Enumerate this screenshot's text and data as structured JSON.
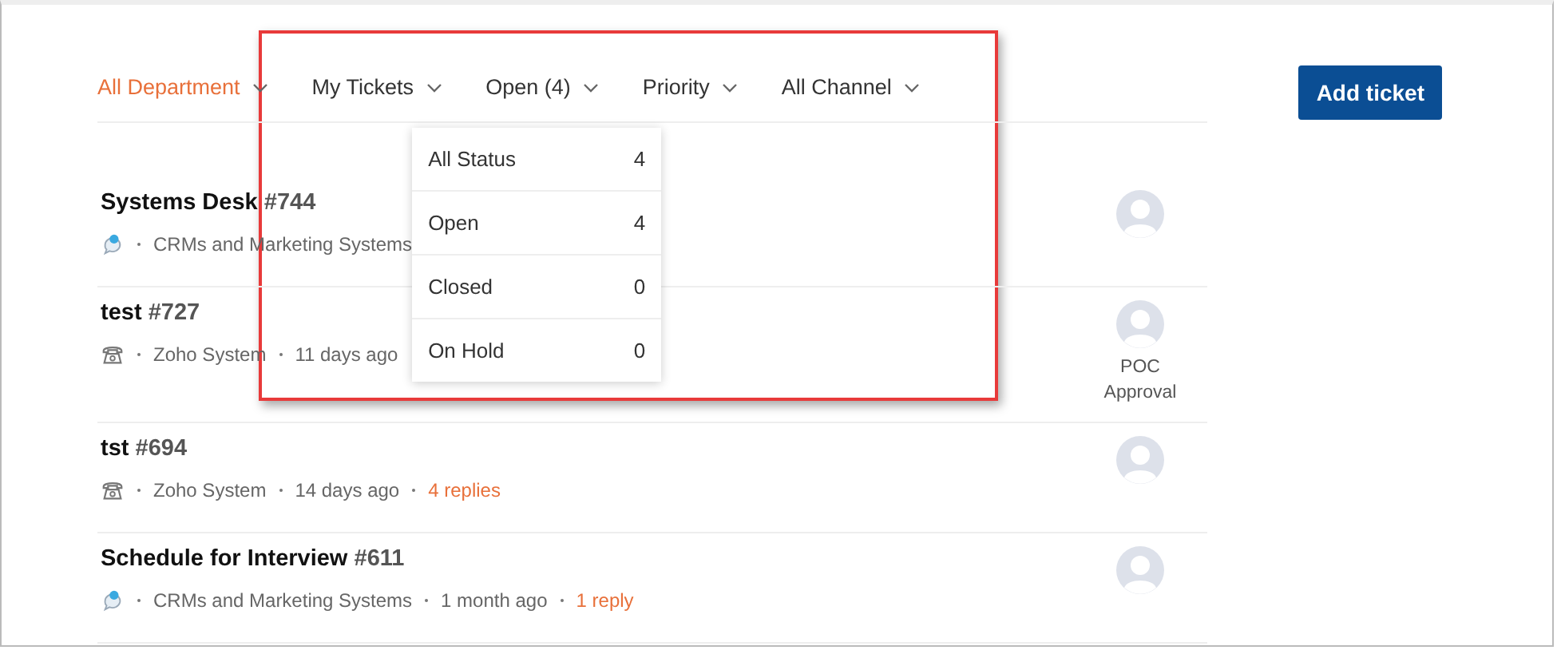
{
  "filters": [
    {
      "label": "All Department",
      "selected": true
    },
    {
      "label": "My Tickets",
      "selected": false
    },
    {
      "label": "Open (4)",
      "selected": false,
      "menu": [
        {
          "label": "All Status",
          "count": "4"
        },
        {
          "label": "Open",
          "count": "4"
        },
        {
          "label": "Closed",
          "count": "0"
        },
        {
          "label": "On Hold",
          "count": "0"
        }
      ]
    },
    {
      "label": "Priority",
      "selected": false
    },
    {
      "label": "All Channel",
      "selected": false
    }
  ],
  "add_button": "Add ticket",
  "tickets": [
    {
      "title": "Systems Desk",
      "number": "#744",
      "kind": "chat",
      "department": "CRMs and Marketing Systems"
    },
    {
      "title": "test",
      "number": "#727",
      "kind": "phone",
      "department": "Zoho System",
      "time": "11 days ago",
      "assignee": "POC Approval"
    },
    {
      "title": "tst",
      "number": "#694",
      "kind": "phone",
      "department": "Zoho System",
      "time": "14 days ago",
      "replies": "4 replies"
    },
    {
      "title": "Schedule for Interview",
      "number": "#611",
      "kind": "chat",
      "department": "CRMs and Marketing Systems",
      "time": "1 month ago",
      "replies": "1 reply"
    }
  ]
}
